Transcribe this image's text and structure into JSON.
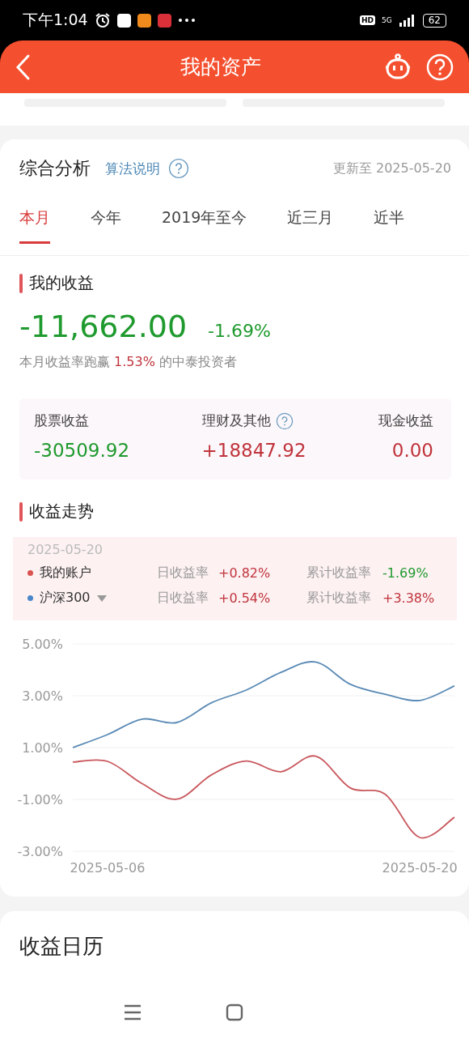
{
  "status_bar": {
    "time": "下午1:04",
    "hd": "HD",
    "network": "5G",
    "battery": "62"
  },
  "header": {
    "title": "我的资产"
  },
  "analysis": {
    "title": "综合分析",
    "link": "算法说明",
    "updated": "更新至 2025-05-20",
    "tabs": [
      {
        "label": "本月",
        "selected": true
      },
      {
        "label": "今年",
        "selected": false
      },
      {
        "label": "2019年至今",
        "selected": false
      },
      {
        "label": "近三月",
        "selected": false
      },
      {
        "label": "近半",
        "selected": false
      }
    ],
    "income": {
      "title": "我的收益",
      "amount": "-11,662.00",
      "rate": "-1.69%",
      "beat_prefix": "本月收益率跑赢",
      "beat_value": "1.53%",
      "beat_suffix": "的中泰投资者",
      "breakdown": [
        {
          "label": "股票收益",
          "value": "-30509.92",
          "color": "#1f9a2e",
          "help": false
        },
        {
          "label": "理财及其他",
          "value": "+18847.92",
          "color": "#c0343c",
          "help": true
        },
        {
          "label": "现金收益",
          "value": "0.00",
          "color": "#c0343c",
          "help": false
        }
      ]
    },
    "trend": {
      "title": "收益走势",
      "date": "2025-05-20",
      "legend": [
        {
          "name": "我的账户",
          "color": "#d9534f",
          "dropdown": false,
          "daily": {
            "label": "日收益率",
            "value": "+0.82%",
            "color": "#c0343c"
          },
          "total": {
            "label": "累计收益率",
            "value": "-1.69%",
            "color": "#1f9a2e"
          }
        },
        {
          "name": "沪深300",
          "color": "#4a86c8",
          "dropdown": true,
          "daily": {
            "label": "日收益率",
            "value": "+0.54%",
            "color": "#c0343c"
          },
          "total": {
            "label": "累计收益率",
            "value": "+3.38%",
            "color": "#c0343c"
          }
        }
      ],
      "chart_data": {
        "type": "line",
        "grid": true,
        "categories": [
          null,
          "2025-05-06",
          null,
          null,
          null,
          null,
          null,
          null,
          null,
          null,
          "2025-05-20",
          null
        ],
        "ylim": [
          -3,
          5
        ],
        "yticks": [
          {
            "value": 5,
            "label": "5.00%"
          },
          {
            "value": 3,
            "label": "3.00%"
          },
          {
            "value": 1,
            "label": "1.00%"
          },
          {
            "value": -1,
            "label": "-1.00%"
          },
          {
            "value": -3,
            "label": "-3.00%"
          }
        ],
        "series": [
          {
            "color": "#c9585e",
            "values": [
              0.44,
              0.47,
              -0.39,
              -0.99,
              -0.05,
              0.48,
              0.07,
              0.67,
              -0.56,
              -0.8,
              -2.47,
              -1.69
            ]
          },
          {
            "color": "#5a8ab5",
            "values": [
              1.0,
              1.5,
              2.1,
              1.97,
              2.73,
              3.22,
              3.9,
              4.3,
              3.44,
              3.06,
              2.82,
              3.38
            ]
          }
        ]
      }
    }
  },
  "calendar": {
    "title": "收益日历"
  }
}
